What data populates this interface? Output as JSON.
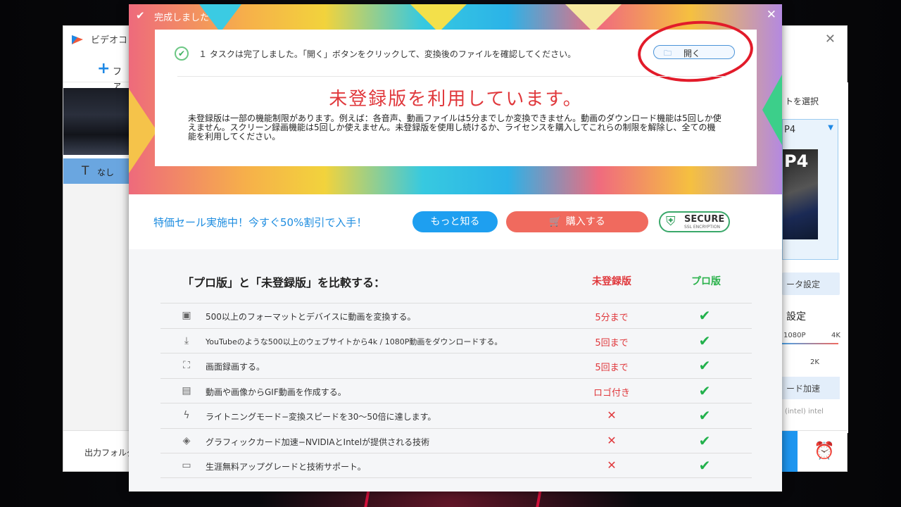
{
  "background_app": {
    "title": "ビデオコ",
    "close_icon": "close-icon",
    "add_label": "ファ",
    "subtitle_value": "なし",
    "output_folder_label": "出力フォルダ",
    "right_panel": {
      "header": "トを選択",
      "format_name": "P4",
      "format_thumb_text": "P4",
      "param_settings_label": "ータ設定",
      "quality_title": "設定",
      "quality_labels": {
        "low": "1080P",
        "high": "4K",
        "mid": "2K"
      },
      "hw_accel_label": "ード加速",
      "brands": "(intel)  intel"
    }
  },
  "dialog": {
    "title": "完成しました",
    "task_message": "１ タスクは完了しました。「開く」ボタンをクリックして、変換後のファイルを確認してください。",
    "open_button_label": "開く",
    "unregistered_heading": "未登録版を利用しています。",
    "unregistered_description": "未登録版は一部の機能制限があります。例えば：各音声、動画ファイルは5分までしか変換できません。動画のダウンロード機能は5回しか使えません。スクリーン録画機能は5回しか使えません。未登録版を使用し続けるか、ライセンスを購入してこれらの制限を解除し、全ての機能を利用してください。",
    "promo_text": "特価セール実施中！今すぐ50%割引で入手！",
    "learn_more_label": "もっと知る",
    "buy_label": "購入する",
    "secure_badge": {
      "label": "SECURE",
      "sub": "SSL ENCRYPTION"
    },
    "compare_title": "「プロ版」と「未登録版」を比較する：",
    "column_unregistered": "未登録版",
    "column_pro": "プロ版",
    "features": [
      {
        "icon": "convert-icon",
        "text": "500以上のフォーマットとデバイスに動画を変換する。",
        "unregistered": "5分まで",
        "pro": "✔"
      },
      {
        "icon": "download-icon",
        "text": "YouTubeのような500以上のウェブサイトから4k / 1080P動画をダウンロードする。",
        "unregistered": "5回まで",
        "pro": "✔"
      },
      {
        "icon": "screen-record-icon",
        "text": "画面録画する。",
        "unregistered": "5回まで",
        "pro": "✔"
      },
      {
        "icon": "gif-icon",
        "text": "動画や画像からGIF動画を作成する。",
        "unregistered": "ロゴ付き",
        "pro": "✔"
      },
      {
        "icon": "lightning-icon",
        "text": "ライトニングモード−変換スピードを30〜50倍に達します。",
        "unregistered": "✕",
        "pro": "✔"
      },
      {
        "icon": "gpu-icon",
        "text": "グラフィックカード加速−NVIDIAとIntelが提供される技術",
        "unregistered": "✕",
        "pro": "✔"
      },
      {
        "icon": "support-icon",
        "text": "生涯無料アップグレードと技術サポート。",
        "unregistered": "✕",
        "pro": "✔"
      }
    ]
  },
  "colors": {
    "accent_blue": "#1e9ff0",
    "buy_red": "#f06a5e",
    "unregistered_red": "#e0383c",
    "pro_green": "#22b14c"
  }
}
